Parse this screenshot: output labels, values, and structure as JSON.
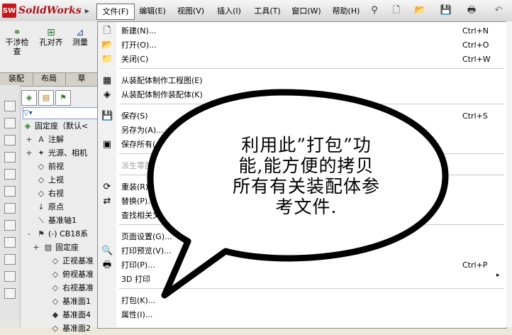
{
  "app": {
    "logo_text": "SolidWorks",
    "logo_mark": "SW"
  },
  "menubar": [
    "文件(F)",
    "编辑(E)",
    "视图(V)",
    "插入(I)",
    "工具(T)",
    "窗口(W)",
    "帮助(H)"
  ],
  "toolbar_buttons": [
    {
      "label": "干涉检\n查",
      "icon": "interference-icon"
    },
    {
      "label": "孔对齐",
      "icon": "hole-align-icon"
    },
    {
      "label": "测量",
      "icon": "measure-icon"
    }
  ],
  "command_tabs": [
    "装配",
    "布局",
    "草"
  ],
  "tree": {
    "filter": "",
    "root": "固定座（默认<",
    "items": [
      {
        "label": "注解",
        "expander": "+"
      },
      {
        "label": "光源、相机",
        "expander": "+"
      },
      {
        "label": "前视",
        "expander": ""
      },
      {
        "label": "上视",
        "expander": ""
      },
      {
        "label": "右视",
        "expander": ""
      },
      {
        "label": "原点",
        "expander": ""
      },
      {
        "label": "基准轴1",
        "expander": ""
      },
      {
        "label": "(-) CB18系",
        "expander": "-"
      },
      {
        "label": "固定座",
        "expander": "+"
      },
      {
        "label": "正视基准",
        "expander": ""
      },
      {
        "label": "俯视基准",
        "expander": ""
      },
      {
        "label": "右视基准",
        "expander": ""
      },
      {
        "label": "基准面1",
        "expander": ""
      },
      {
        "label": "基准面4",
        "expander": ""
      },
      {
        "label": "基准面2",
        "expander": ""
      }
    ]
  },
  "file_menu": {
    "items": [
      {
        "label": "新建(N)...",
        "shortcut": "Ctrl+N"
      },
      {
        "label": "打开(O)...",
        "shortcut": "Ctrl+O"
      },
      {
        "label": "关闭(C)",
        "shortcut": "Ctrl+W"
      },
      {
        "label": "从装配体制作工程图(E)",
        "shortcut": ""
      },
      {
        "label": "从装配体制作装配体(K)",
        "shortcut": ""
      },
      {
        "label": "保存(S)",
        "shortcut": "Ctrl+S"
      },
      {
        "label": "另存为(A)...",
        "shortcut": ""
      },
      {
        "label": "保存所有(",
        "shortcut": ""
      },
      {
        "label": "派生零部",
        "shortcut": ""
      },
      {
        "label": "重装(R)",
        "shortcut": ""
      },
      {
        "label": "替换(P)...",
        "shortcut": ""
      },
      {
        "label": "查找相关文",
        "shortcut": ""
      },
      {
        "label": "页面设置(G)...",
        "shortcut": ""
      },
      {
        "label": "打印预览(V)...",
        "shortcut": ""
      },
      {
        "label": "打印(P)...",
        "shortcut": "Ctrl+P"
      },
      {
        "label": "3D 打印",
        "shortcut": ""
      },
      {
        "label": "打包(K)...",
        "shortcut": ""
      },
      {
        "label": "属性(I)...",
        "shortcut": ""
      }
    ],
    "submenu_arrow": "▸"
  },
  "callout": {
    "lines": [
      "利用此”打包”功",
      "能,能方便的拷贝",
      "所有有关装配体参",
      "考文件."
    ]
  }
}
